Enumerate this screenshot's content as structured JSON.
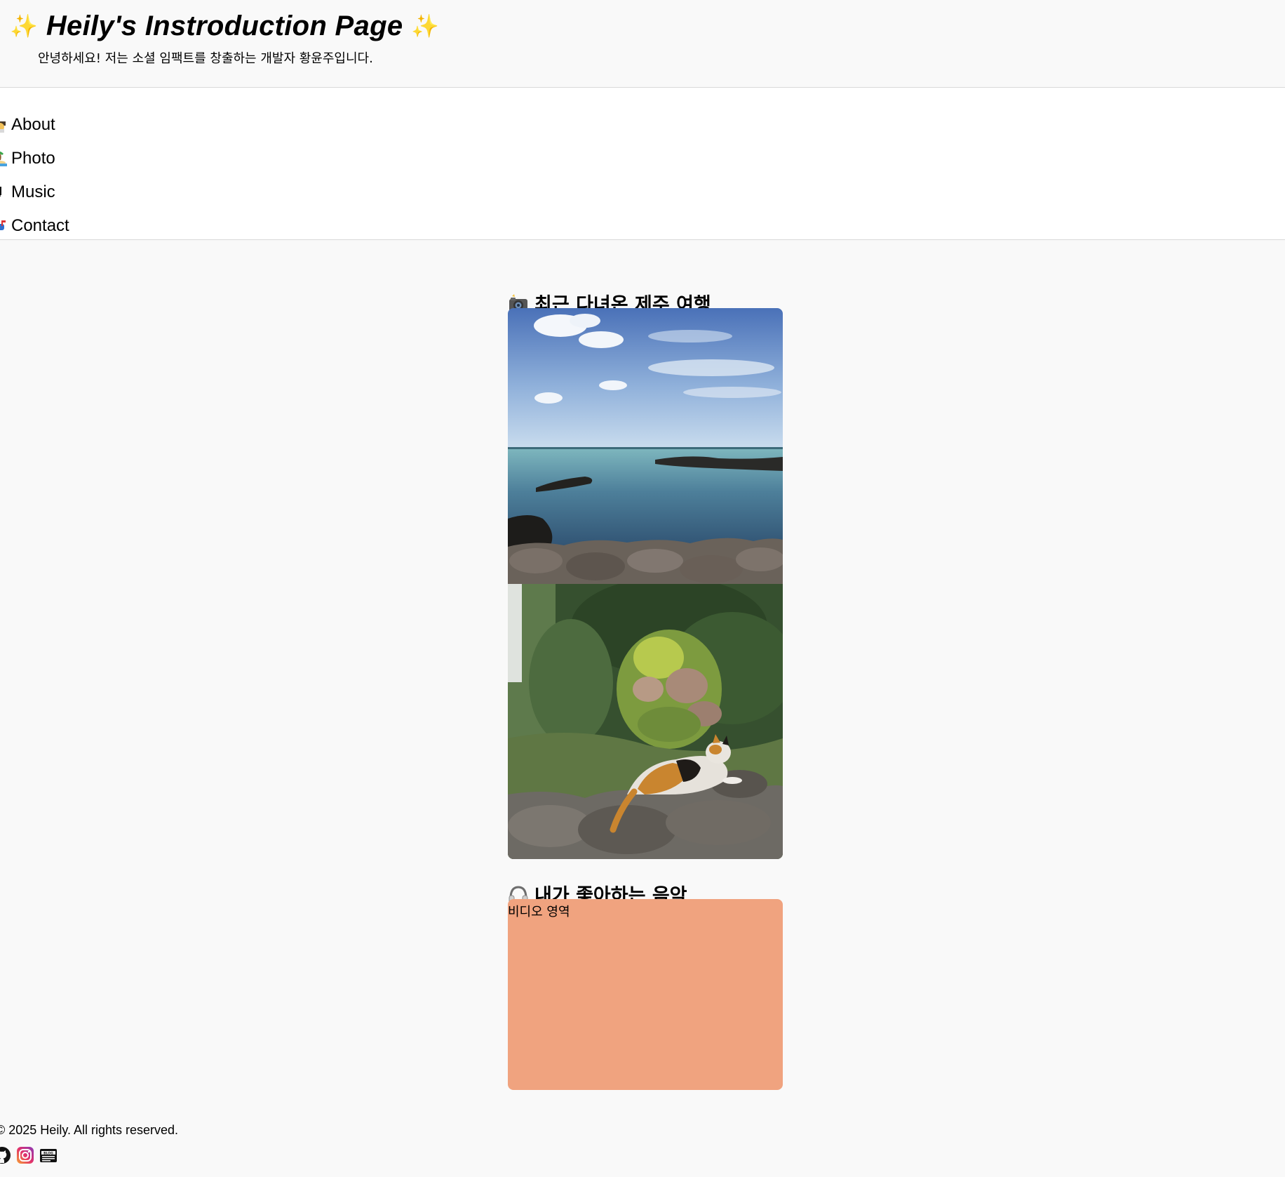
{
  "header": {
    "title": "Heily's Instroduction Page",
    "subtitle": "안녕하세요! 저는 소셜 임팩트를 창출하는 개발자 황윤주입니다.",
    "sparkle_icon": "sparkles-icon"
  },
  "nav": {
    "items": [
      {
        "label": "About",
        "icon": "student-icon"
      },
      {
        "label": "Photo",
        "icon": "beach-icon"
      },
      {
        "label": "Music",
        "icon": "music-note-icon"
      },
      {
        "label": "Contact",
        "icon": "mailbox-icon"
      }
    ]
  },
  "photos_section": {
    "title": "최근 다녀온 제주 여행",
    "icon": "camera-flash-icon"
  },
  "music_section": {
    "title": "내가 좋아하는 음악",
    "icon": "headphones-icon",
    "video_placeholder": "비디오 영역",
    "video_bg_color": "#f0a37f"
  },
  "footer": {
    "copyright": "© 2025 Heily. All rights reserved.",
    "social": [
      "github-icon",
      "instagram-icon",
      "blog-icon"
    ]
  }
}
